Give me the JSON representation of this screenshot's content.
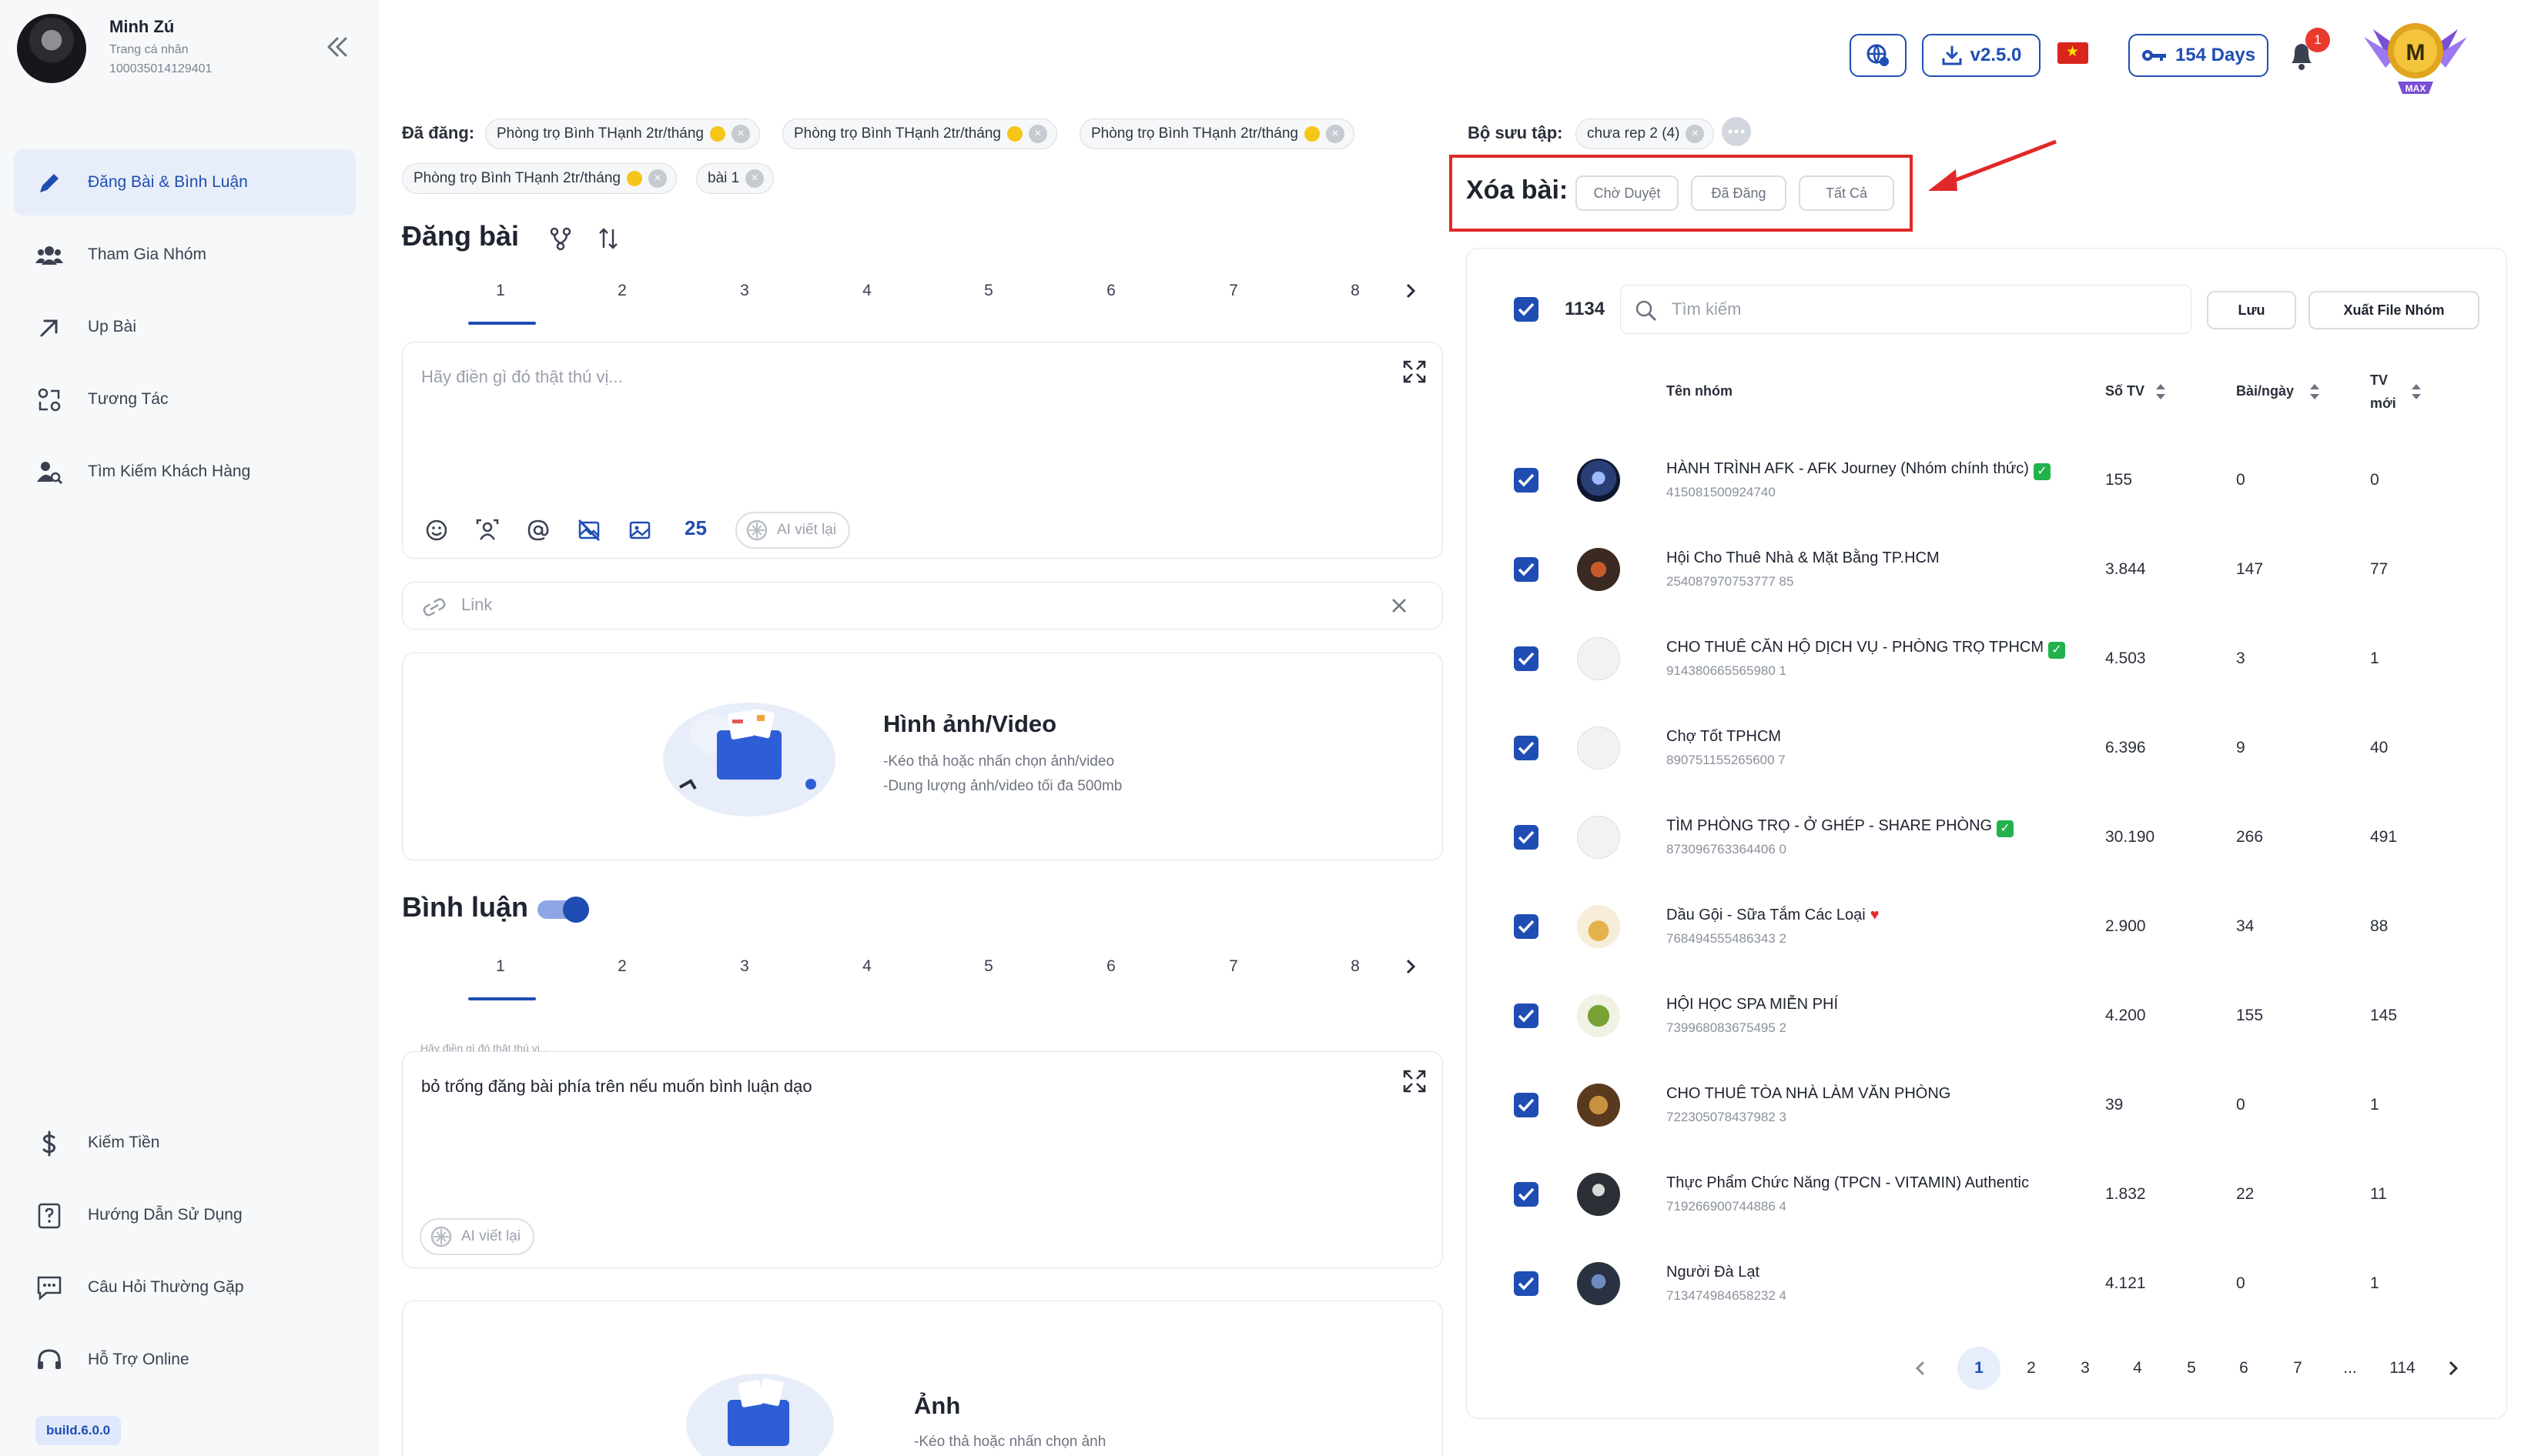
{
  "user": {
    "name": "Minh Zú",
    "subtitle": "Trang cá nhân",
    "id": "100035014129401"
  },
  "sidebar": {
    "items": [
      {
        "label": "Đăng Bài & Bình Luận",
        "icon": "pencil-icon",
        "active": true
      },
      {
        "label": "Tham Gia Nhóm",
        "icon": "users-icon"
      },
      {
        "label": "Up Bài",
        "icon": "arrow-up-right-icon"
      },
      {
        "label": "Tương Tác",
        "icon": "interact-icon"
      },
      {
        "label": "Tìm Kiếm Khách Hàng",
        "icon": "user-search-icon"
      }
    ],
    "bottom_items": [
      {
        "label": "Kiếm Tiền",
        "icon": "dollar-icon"
      },
      {
        "label": "Hướng Dẫn Sử Dụng",
        "icon": "question-book-icon"
      },
      {
        "label": "Câu Hỏi Thường Gặp",
        "icon": "faq-icon"
      },
      {
        "label": "Hỗ Trợ Online",
        "icon": "headset-icon"
      }
    ],
    "build": "build.6.0.0"
  },
  "topbar": {
    "version": "v2.5.0",
    "days": "154 Days",
    "notifications": "1",
    "badge_letter": "M",
    "badge_text": "MAX"
  },
  "posted": {
    "label": "Đã đăng:",
    "chips": [
      "Phòng trọ Bình THạnh 2tr/tháng",
      "Phòng trọ Bình THạnh 2tr/tháng",
      "Phòng trọ Bình THạnh 2tr/tháng",
      "Phòng trọ Bình THạnh 2tr/tháng",
      "bài 1"
    ]
  },
  "collection": {
    "label": "Bộ sưu tập:",
    "chip": "chưa rep 2 (4)"
  },
  "delete": {
    "label": "Xóa bài:",
    "buttons": [
      "Chờ Duyệt",
      "Đã Đăng",
      "Tất Cả"
    ]
  },
  "post": {
    "title": "Đăng bài",
    "tabs": [
      "1",
      "2",
      "3",
      "4",
      "5",
      "6",
      "7",
      "8"
    ],
    "placeholder": "Hãy điền gì đó thật thú vị...",
    "count": "25",
    "ai_label": "AI viết lại",
    "link_placeholder": "Link"
  },
  "media": {
    "title": "Hình ảnh/Video",
    "line1": "-Kéo thả hoặc nhấn chọn ảnh/video",
    "line2": "-Dung lượng ảnh/video tối đa 500mb"
  },
  "comment": {
    "title": "Bình luận",
    "tabs": [
      "1",
      "2",
      "3",
      "4",
      "5",
      "6",
      "7",
      "8"
    ],
    "mini_placeholder": "Hãy điền gì đó thật thú vị...",
    "text": "bỏ trống đăng bài phía trên nếu muốn bình luận dạo",
    "ai_label": "AI viết lại"
  },
  "image_upload": {
    "title": "Ảnh",
    "line1": "-Kéo thả hoặc nhấn chọn ảnh"
  },
  "groups": {
    "total": "1134",
    "search_placeholder": "Tìm kiếm",
    "save_label": "Lưu",
    "export_label": "Xuất File Nhóm",
    "headers": {
      "name": "Tên nhóm",
      "members": "Số TV",
      "posts": "Bài/ngày",
      "new1": "TV",
      "new2": "mới"
    },
    "rows": [
      {
        "name": "HÀNH TRÌNH AFK - AFK Journey (Nhóm chính thức)",
        "badge": "check",
        "id": "415081500924740",
        "members": "155",
        "posts": "0",
        "new": "0"
      },
      {
        "name": "Hội Cho Thuê Nhà & Mặt Bằng TP.HCM",
        "badge": "",
        "id": "254087970753777 85",
        "members": "3.844",
        "posts": "147",
        "new": "77"
      },
      {
        "name": "CHO THUÊ CĂN HỘ DỊCH VỤ - PHÒNG TRỌ TPHCM",
        "badge": "check",
        "id": "914380665565980 1",
        "members": "4.503",
        "posts": "3",
        "new": "1"
      },
      {
        "name": "Chợ Tốt TPHCM",
        "badge": "",
        "id": "890751155265600 7",
        "members": "6.396",
        "posts": "9",
        "new": "40"
      },
      {
        "name": "TÌM PHÒNG TRỌ - Ở GHÉP - SHARE PHÒNG",
        "badge": "check",
        "id": "873096763364406 0",
        "members": "30.190",
        "posts": "266",
        "new": "491"
      },
      {
        "name": "Dầu Gội - Sữa Tắm Các Loại",
        "badge": "heart",
        "id": "768494555486343 2",
        "members": "2.900",
        "posts": "34",
        "new": "88"
      },
      {
        "name": "HỘI HỌC SPA MIỄN PHÍ",
        "badge": "",
        "id": "739968083675495 2",
        "members": "4.200",
        "posts": "155",
        "new": "145"
      },
      {
        "name": "CHO THUÊ TÒA NHÀ LÀM VĂN PHÒNG",
        "badge": "",
        "id": "722305078437982 3",
        "members": "39",
        "posts": "0",
        "new": "1"
      },
      {
        "name": "Thực Phẩm Chức Năng (TPCN - VITAMIN) Authentic",
        "badge": "",
        "id": "719266900744886 4",
        "members": "1.832",
        "posts": "22",
        "new": "11"
      },
      {
        "name": "Người Đà Lạt",
        "badge": "",
        "id": "713474984658232 4",
        "members": "4.121",
        "posts": "0",
        "new": "1"
      }
    ],
    "pagination": [
      "1",
      "2",
      "3",
      "4",
      "5",
      "6",
      "7",
      "...",
      "114"
    ]
  },
  "colors": {
    "primary": "#1f4db3",
    "highlight": "#e12828",
    "active_bg": "#e8eef9"
  }
}
